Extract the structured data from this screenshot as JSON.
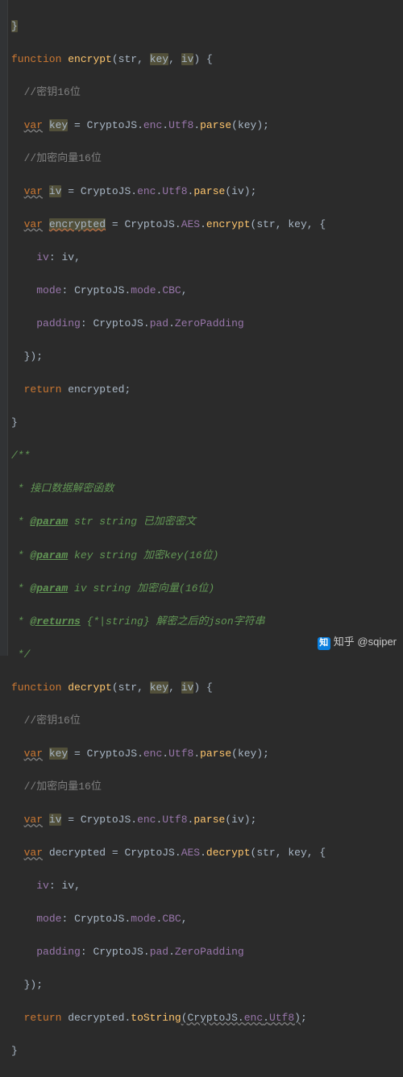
{
  "code": {
    "l0_brace": "}",
    "fn_kw": "function",
    "encrypt_name": "encrypt",
    "decrypt_name": "decrypt",
    "params": {
      "str": "str",
      "key": "key",
      "iv": "iv"
    },
    "brace_open": "{",
    "brace_close": "}",
    "paren": {
      "open": "(",
      "close": ")"
    },
    "comma": ",",
    "semi": ";",
    "colon": ":",
    "eq": " = ",
    "cmt_key16": "//密钥16位",
    "cmt_iv16": "//加密向量16位",
    "var_kw": "var",
    "key_id": "key",
    "iv_id": "iv",
    "encrypted_id": "encrypted",
    "decrypted_id": "decrypted",
    "cryptojs": "CryptoJS",
    "enc": "enc",
    "utf8": "Utf8",
    "parse_fn": "parse",
    "aes": "AES",
    "encrypt_fn": "encrypt",
    "decrypt_fn": "decrypt",
    "iv_prop": "iv",
    "mode_prop": "mode",
    "mode_path": "mode",
    "cbc": "CBC",
    "padding_prop": "padding",
    "pad_path": "pad",
    "zeropadding": "ZeroPadding",
    "close_opts": "})",
    "return_kw": "return",
    "return_enc": "encrypted",
    "return_dec": "decrypted",
    "tostring": "toString",
    "dot": ".",
    "doc": {
      "open": "/**",
      "line1": " * 接口数据解密函数",
      "param_tag": "@param",
      "p1_rest": " str string 已加密密文",
      "p2_rest": " key string 加密key(16位)",
      "p3_rest": " iv string 加密向量(16位)",
      "returns_tag": "@returns",
      "returns_rest": " {*|string} 解密之后的json字符串",
      "close": " */"
    }
  },
  "watermark": {
    "logo": "知",
    "text": "知乎 @sqiper"
  }
}
